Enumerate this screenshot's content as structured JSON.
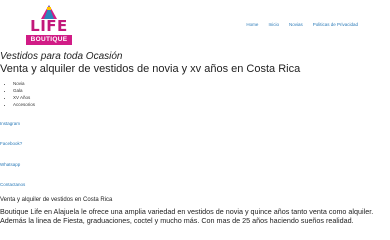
{
  "header": {
    "logo_main": "LIFE",
    "logo_sub": "BOUTIQUE",
    "nav": [
      "Home",
      "Inicio",
      "Novias",
      "Politicas de Privacidad"
    ]
  },
  "hero": {
    "tagline": "Vestidos para toda Ocasión",
    "headline": "Venta y alquiler de vestidos de novia y xv años en Costa Rica"
  },
  "menu": [
    "Novia",
    "Gala",
    "XV Años",
    "Accesorios"
  ],
  "social": [
    "Instagram",
    "Facebook?",
    "Whatsapp",
    "Contactanos"
  ],
  "content": {
    "subheading": "Venta y alquiler de vestidos en Costa Rica",
    "paragraph": "Boutique Life en Alajuela le ofrece una amplia variedad en vestidos de novia y quince años tanto venta como alquiler. Además la linea de Fiesta, graduaciones, coctel y mucho más. Con mas de 25 años haciendo sueños realidad."
  },
  "colors": {
    "brand": "#c2187a",
    "link": "#2a7ab8"
  }
}
